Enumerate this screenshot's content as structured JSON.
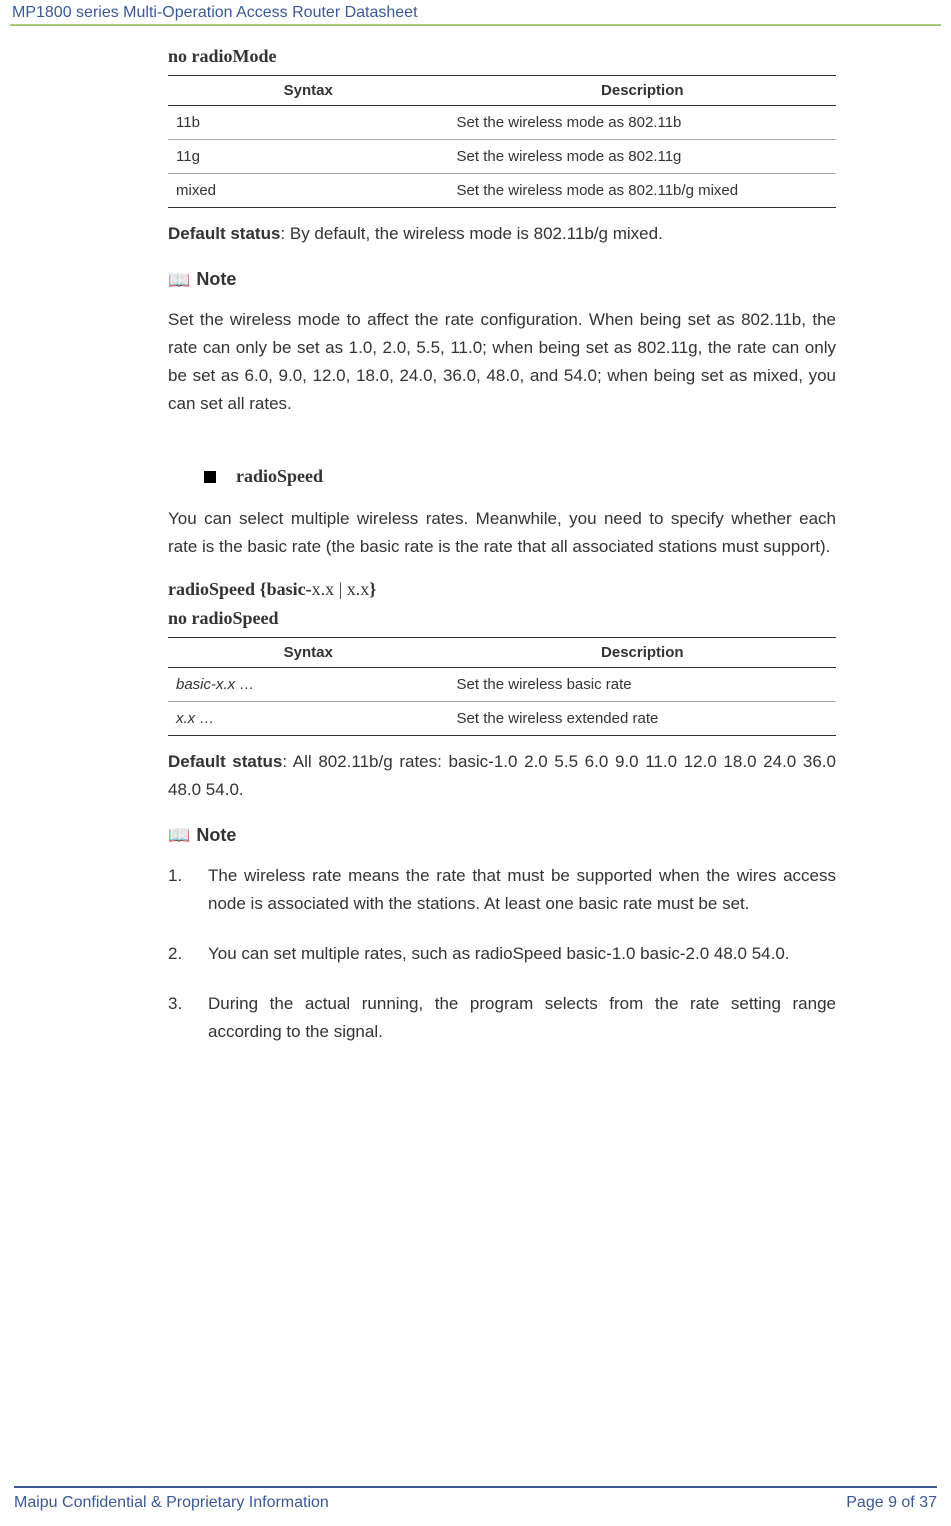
{
  "header": {
    "title": "MP1800 series Multi-Operation Access Router Datasheet"
  },
  "section1": {
    "cmd_no": "no radioMode",
    "table": {
      "th_syntax": "Syntax",
      "th_description": "Description",
      "rows": [
        {
          "syntax": "11b",
          "description": "Set the wireless mode as 802.11b"
        },
        {
          "syntax": "11g",
          "description": "Set the wireless mode as 802.11g"
        },
        {
          "syntax": "mixed",
          "description": "Set the wireless mode as 802.11b/g mixed"
        }
      ]
    },
    "default_status_label": "Default status",
    "default_status_text": ": By default, the wireless mode is 802.11b/g mixed.",
    "note_label": "Note",
    "note_text": "Set the wireless mode to affect the rate configuration. When being set as 802.11b, the rate can only be set as 1.0, 2.0, 5.5, 11.0; when being set as 802.11g, the rate can only be set as 6.0, 9.0, 12.0, 18.0, 24.0, 36.0, 48.0, and 54.0; when being set as mixed, you can set all rates."
  },
  "section2": {
    "heading": "radioSpeed",
    "intro": "You can select multiple wireless rates. Meanwhile, you need to specify whether each rate is the basic rate (the basic rate is the rate that all associated stations must support).",
    "cmd_bold1": "radioSpeed ",
    "cmd_bold2": "{",
    "cmd_bold3": "basic-",
    "cmd_plain1": "x.x | x.x",
    "cmd_bold4": "}",
    "cmd_no": "no radioSpeed",
    "table": {
      "th_syntax": "Syntax",
      "th_description": "Description",
      "rows": [
        {
          "syntax": "basic-x.x …",
          "description": "Set the wireless basic rate"
        },
        {
          "syntax": "x.x …",
          "description": "Set the wireless extended rate"
        }
      ]
    },
    "default_status_label": "Default status",
    "default_status_text": ": All 802.11b/g rates: basic-1.0 2.0 5.5 6.0 9.0 11.0 12.0 18.0 24.0 36.0 48.0 54.0.",
    "note_label": "Note",
    "list": [
      "The wireless rate means the rate that must be supported when the wires access node is associated with the stations. At least one basic rate must be set.",
      "You can set multiple rates, such as radioSpeed basic-1.0 basic-2.0 48.0 54.0.",
      "During the actual running, the program selects from the rate setting range according to the signal."
    ]
  },
  "footer": {
    "left": "Maipu Confidential & Proprietary Information",
    "right": "Page 9 of 37"
  }
}
